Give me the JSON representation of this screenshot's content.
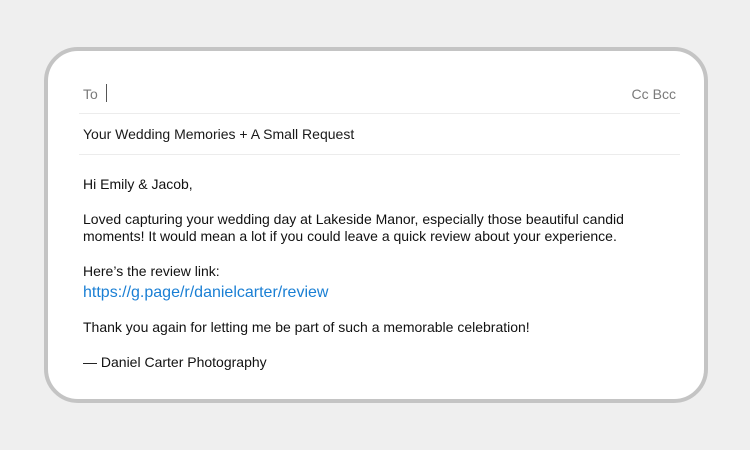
{
  "compose": {
    "to_label": "To",
    "cc_label": "Cc",
    "bcc_label": "Bcc",
    "subject": "Your Wedding Memories + A Small Request",
    "body": {
      "greeting": "Hi Emily & Jacob,",
      "paragraph_main": "Loved capturing your wedding day at Lakeside Manor, especially those beautiful candid moments! It would mean a lot if you could leave a quick review about your experience.",
      "link_label": "Here’s the review link:",
      "review_link": "https://g.page/r/danielcarter/review",
      "thanks": "Thank you again for letting me be part of such a memorable celebration!",
      "signature": "— Daniel Carter Photography"
    }
  },
  "colors": {
    "background": "#efefef",
    "card_border": "#c4c4c4",
    "link": "#1a7fd4",
    "muted_text": "#7a7a7a"
  }
}
